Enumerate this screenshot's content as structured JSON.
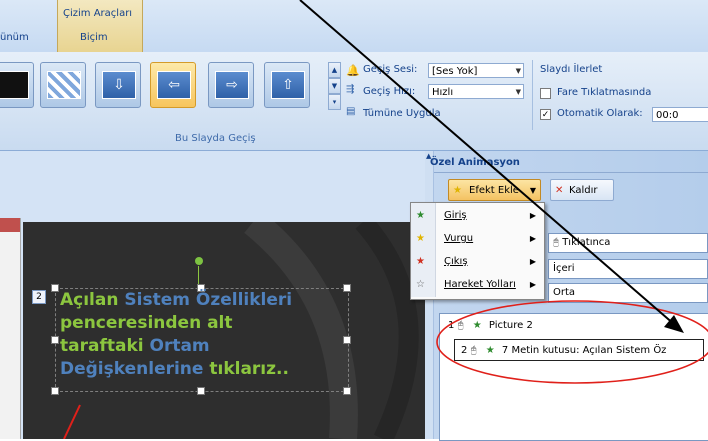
{
  "ribbon": {
    "contextual_tab": "Çizim Araçları",
    "tab_gorunum": "ünüm",
    "tab_bicim": "Biçim",
    "group_label": "Bu Slayda Geçiş",
    "gecis_sesi_label": "Geçiş Sesi:",
    "gecis_sesi_value": "[Ses Yok]",
    "gecis_hizi_label": "Geçiş Hızı:",
    "gecis_hizi_value": "Hızlı",
    "tumune_uygula": "Tümüne Uygula",
    "slayti_ilerlet": "Slaydı İlerlet",
    "fare_tiklatmasinda": "Fare Tıklatmasında",
    "otomatik_olarak": "Otomatik Olarak:",
    "otomatik_value": "00:0",
    "fare_checked": false,
    "otomatik_checked": true
  },
  "task_pane": {
    "title": "Özel Animasyon",
    "efekt_ekle": "Efekt Ekle",
    "kaldir": "Kaldır",
    "field_start": "Tıklatınca",
    "field_direction": "İçeri",
    "field_speed": "Orta",
    "list_items": [
      {
        "index": "1",
        "label": "Picture 2",
        "star_color": "#2e8b2e"
      },
      {
        "index": "2",
        "label": "7 Metin kutusu: Açılan Sistem Öz",
        "star_color": "#2e8b2e"
      }
    ]
  },
  "menu": {
    "items": [
      {
        "label": "Giriş",
        "star_color": "#2e8b2e"
      },
      {
        "label": "Vurgu",
        "star_color": "#e0b400"
      },
      {
        "label": "Çıkış",
        "star_color": "#d03020"
      },
      {
        "label": "Hareket Yolları",
        "star_color": "#666666"
      }
    ]
  },
  "slide": {
    "number_tag": "2",
    "text_line1_a": "Açılan ",
    "text_line1_b": "Sistem ",
    "text_line1_c": "Özellikleri",
    "text_line2": "penceresinden alt",
    "text_line3_a": "taraftaki ",
    "text_line3_b": "Ortam",
    "text_line4_a": "Değişkenlerine ",
    "text_line4_b": "tıklarız..",
    "color_green": "#8cc63f",
    "color_blue": "#4f81bd"
  },
  "annotation": {
    "circle_color": "#e0201a",
    "arrow_color": "#000000"
  }
}
